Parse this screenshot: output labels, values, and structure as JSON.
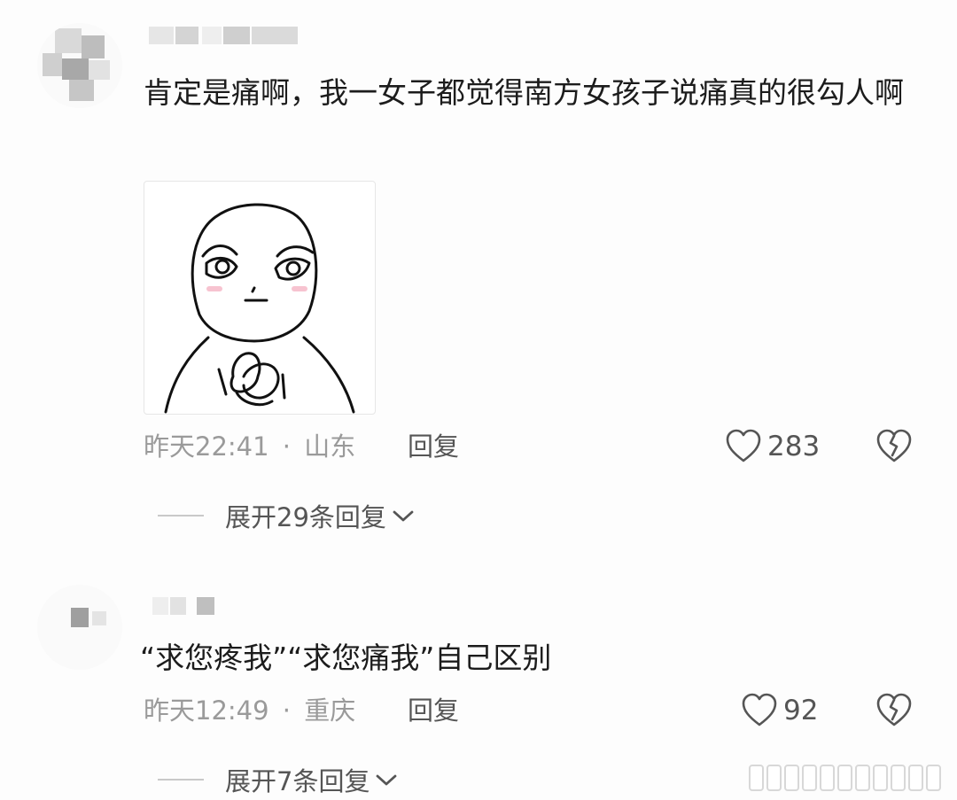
{
  "comments": [
    {
      "text": "肯定是痛啊，我一女子都觉得南方女孩子说痛真的很勾人啊",
      "time": "昨天22:41",
      "location": "山东",
      "separator": "·",
      "reply_label": "回复",
      "likes": "283",
      "expand_label": "展开29条回复",
      "has_sticker": true
    },
    {
      "text": "“求您疼我”“求您痛我”自己区别",
      "time": "昨天12:49",
      "location": "重庆",
      "separator": "·",
      "reply_label": "回复",
      "likes": "92",
      "expand_label": "展开7条回复",
      "has_sticker": false
    }
  ],
  "icons": {
    "like": "heart-outline-icon",
    "dislike": "broken-heart-icon",
    "expand": "chevron-down-icon"
  },
  "colors": {
    "text": "#1c1c1c",
    "meta": "#9a9a9a",
    "action": "#555555",
    "background": "#fdfdfd"
  }
}
